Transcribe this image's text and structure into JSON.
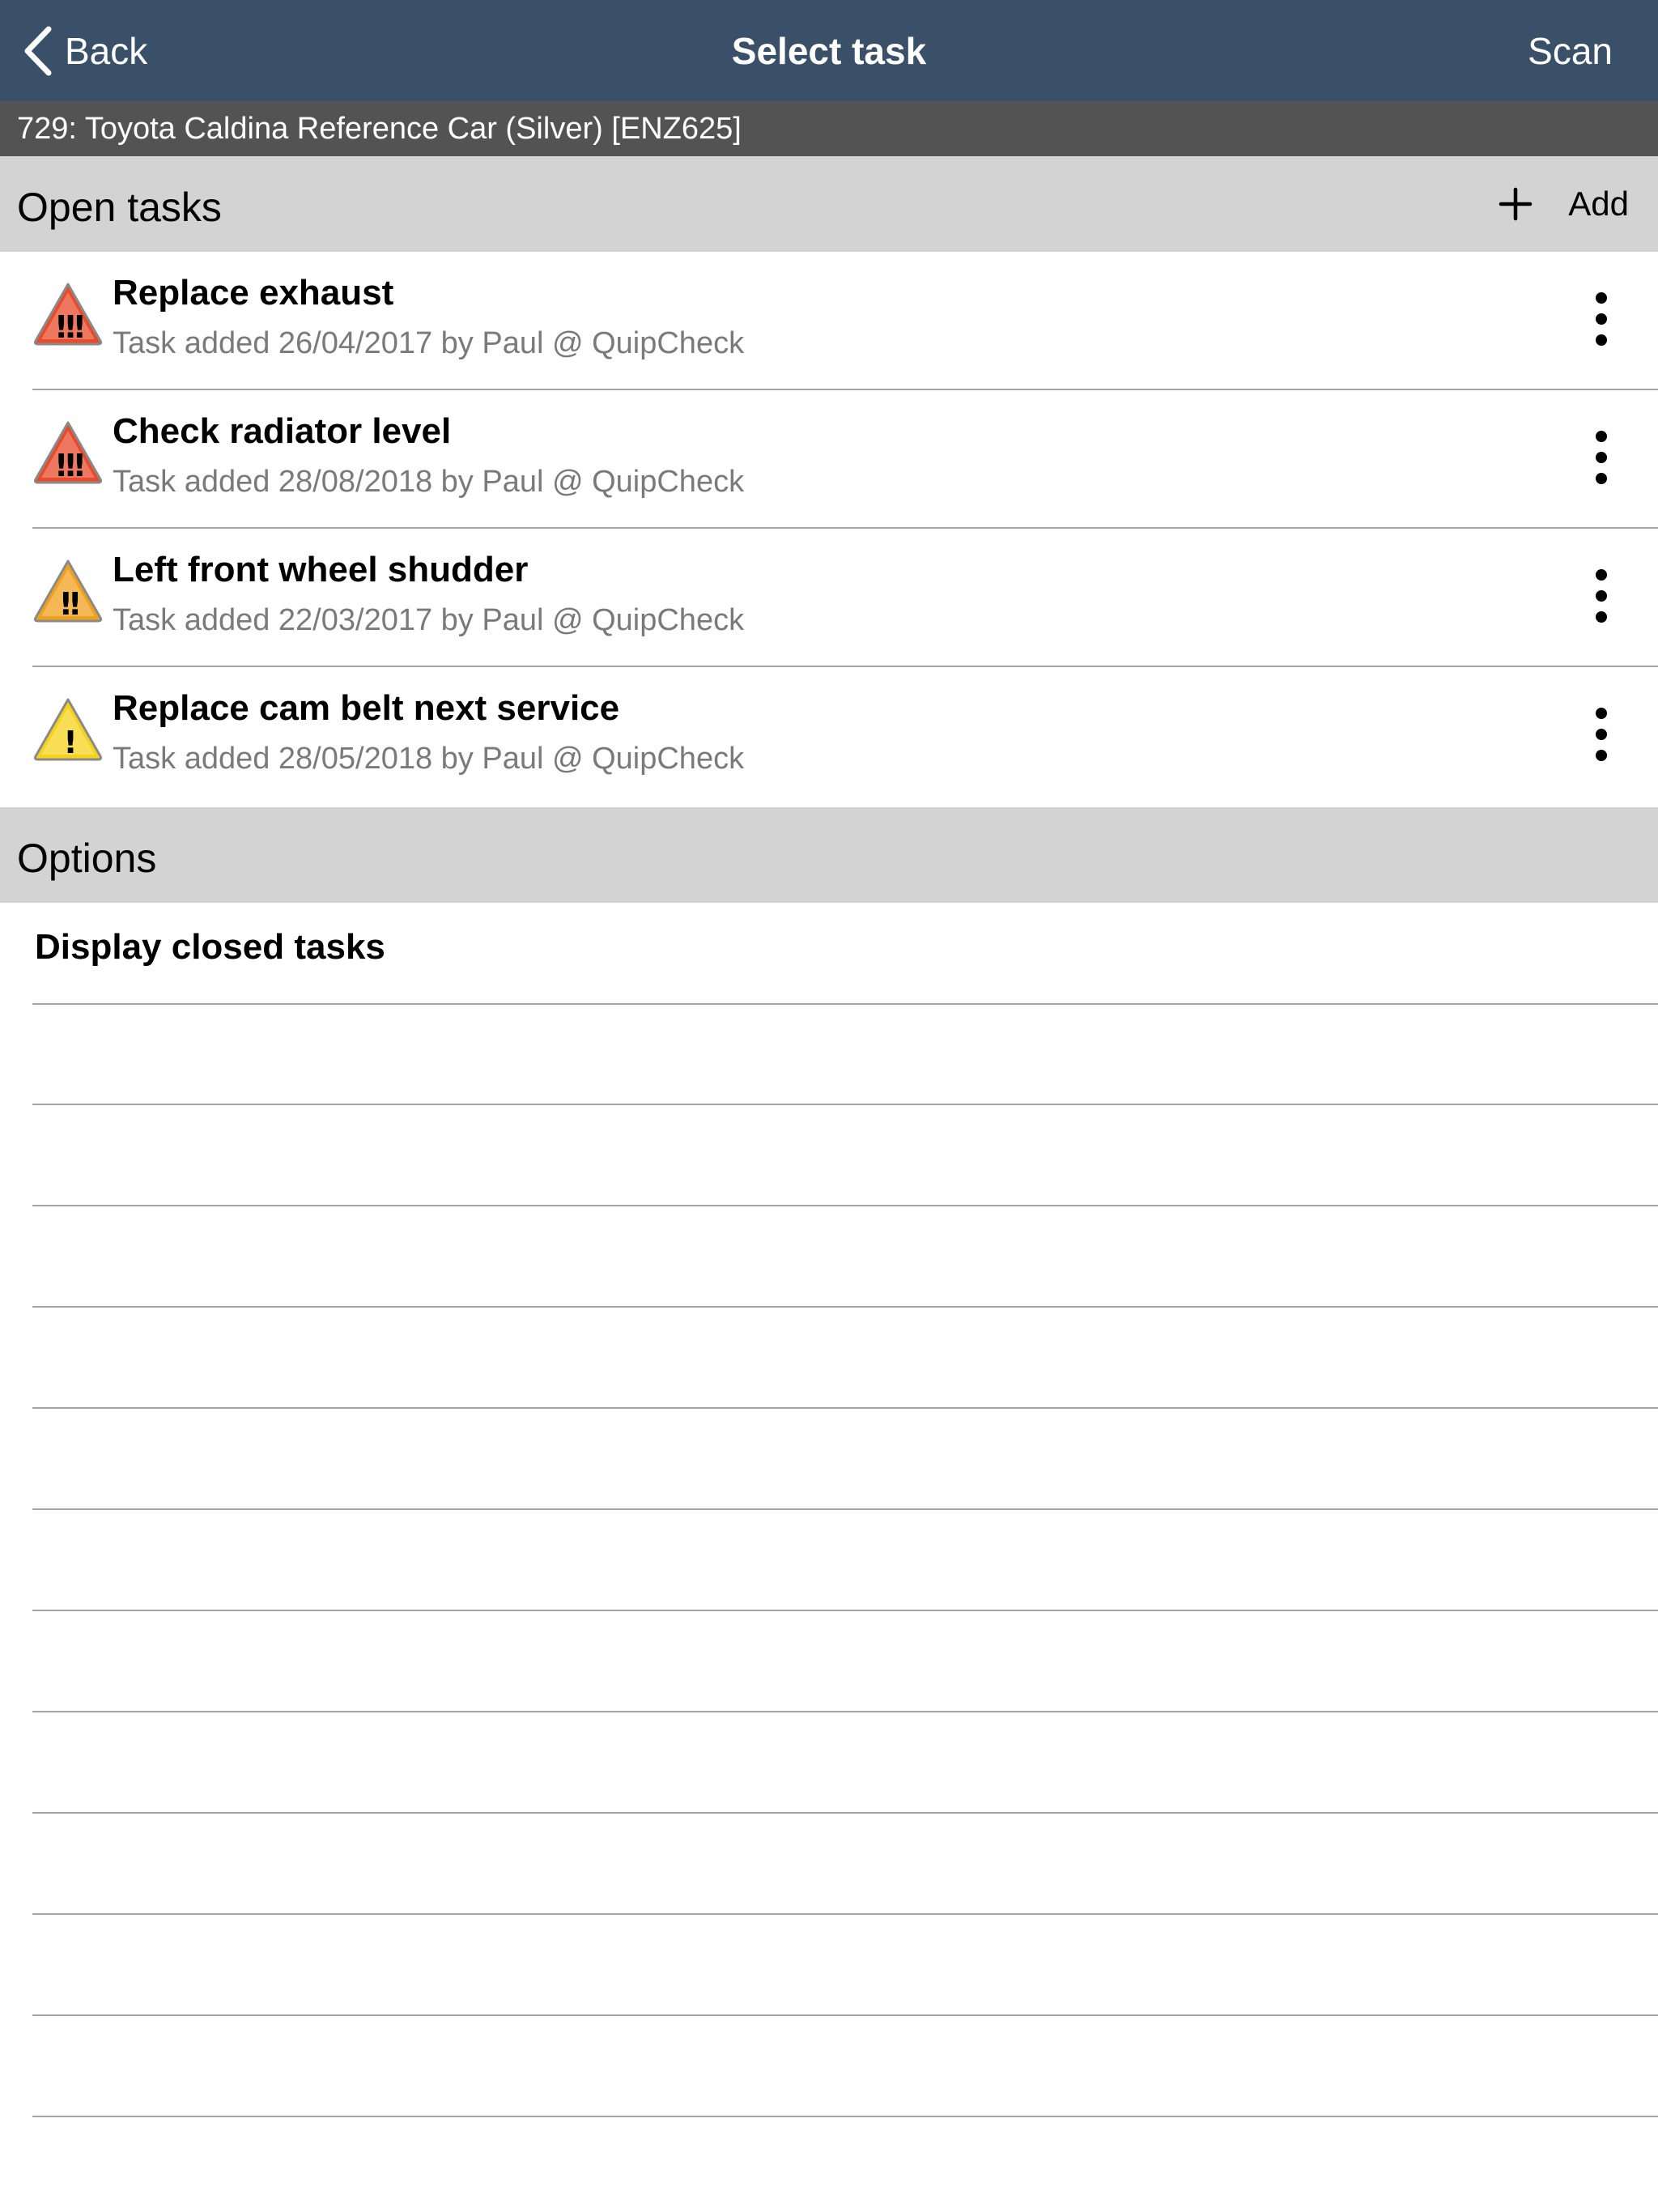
{
  "nav": {
    "back_label": "Back",
    "title": "Select task",
    "scan_label": "Scan",
    "background": "#3a5068"
  },
  "vehicle": {
    "label": "729: Toyota Caldina Reference Car (Silver) [ENZ625]"
  },
  "open_tasks": {
    "title": "Open tasks",
    "add_label": "Add",
    "items": [
      {
        "title": "Replace exhaust",
        "subtitle": "Task added 26/04/2017 by Paul @ QuipCheck",
        "priority_icon": "warning-high-icon",
        "icon_marks": "!!!",
        "icon_color": "#e84a2a"
      },
      {
        "title": "Check radiator level",
        "subtitle": "Task added 28/08/2018 by Paul @ QuipCheck",
        "priority_icon": "warning-high-icon",
        "icon_marks": "!!!",
        "icon_color": "#e84a2a"
      },
      {
        "title": "Left front wheel shudder",
        "subtitle": "Task added 22/03/2017 by Paul @ QuipCheck",
        "priority_icon": "warning-medium-icon",
        "icon_marks": "!!",
        "icon_color": "#f0a21e"
      },
      {
        "title": "Replace cam belt next service",
        "subtitle": "Task added 28/05/2018 by Paul @ QuipCheck",
        "priority_icon": "warning-low-icon",
        "icon_marks": "!",
        "icon_color": "#f5d31c"
      }
    ]
  },
  "options": {
    "title": "Options",
    "items": [
      {
        "label": "Display closed tasks"
      }
    ]
  }
}
